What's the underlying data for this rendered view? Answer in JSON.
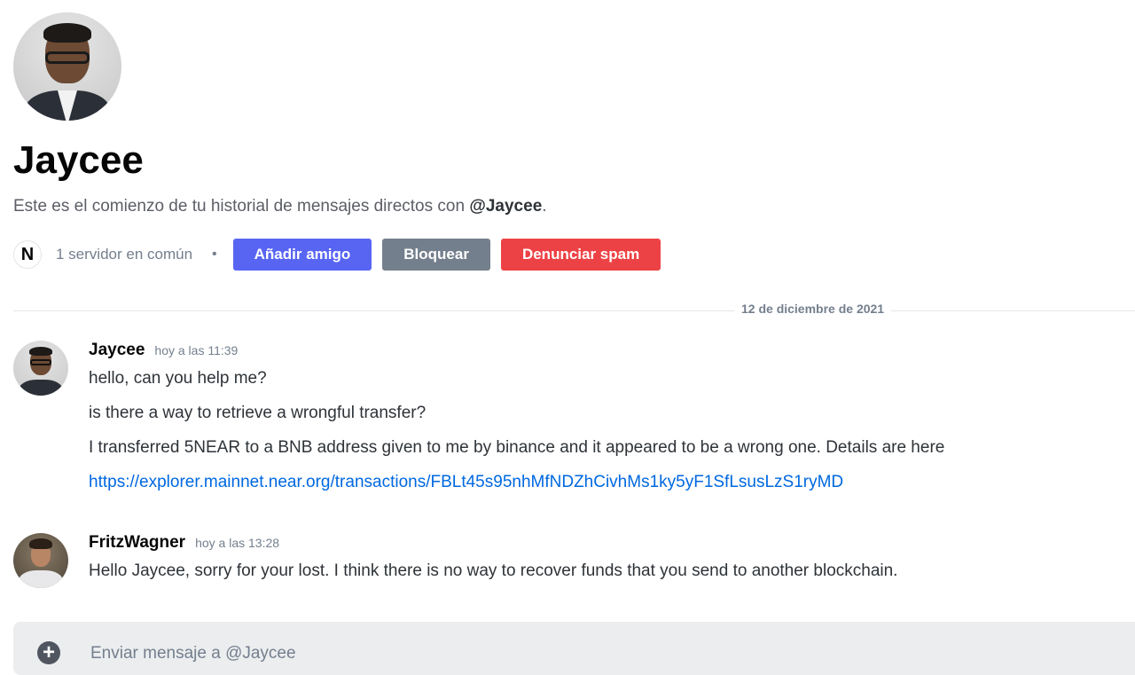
{
  "profile": {
    "name": "Jaycee",
    "intro_prefix": "Este es el comienzo de tu historial de mensajes directos con ",
    "intro_handle": "@Jaycee",
    "intro_suffix": ".",
    "server_icon_glyph": "N",
    "mutual_servers": "1 servidor en común",
    "separator": "•",
    "buttons": {
      "add_friend": "Añadir amigo",
      "block": "Bloquear",
      "report_spam": "Denunciar spam"
    }
  },
  "date_divider": "12 de diciembre de 2021",
  "messages": [
    {
      "author": "Jaycee",
      "time": "hoy a las 11:39",
      "lines": [
        "hello, can you help me?",
        "is there a way to retrieve a wrongful transfer?",
        "I transferred 5NEAR to a BNB address given to me by binance and it appeared to be a wrong one. Details are here"
      ],
      "link": "https://explorer.mainnet.near.org/transactions/FBLt45s95nhMfNDZhCivhMs1ky5yF1SfLsusLzS1ryMD"
    },
    {
      "author": "FritzWagner",
      "time": "hoy a las 13:28",
      "lines": [
        "Hello Jaycee, sorry for your lost. I think there is no way to recover funds that you send to another blockchain."
      ]
    }
  ],
  "composer": {
    "placeholder": "Enviar mensaje a @Jaycee",
    "plus_glyph": "+"
  },
  "colors": {
    "add_friend": "#5865f2",
    "block": "#747f8d",
    "report_spam": "#ed4245",
    "link": "#0068e0"
  }
}
